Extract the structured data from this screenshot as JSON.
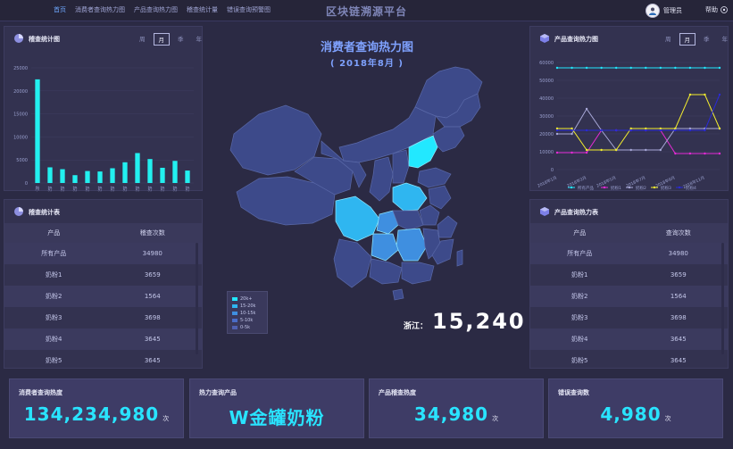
{
  "topbar": {
    "nav": [
      "首页",
      "消费者查询热力图",
      "产品查询热力图",
      "稽查统计量",
      "错误查询预警图"
    ],
    "brand": "区块链溯源平台",
    "user_name": "管理员",
    "help_label": "帮助"
  },
  "audit_chart_panel": {
    "title": "稽查统计图",
    "periods": [
      "周",
      "月",
      "季",
      "年"
    ],
    "active_period": "月"
  },
  "product_chart_panel": {
    "title": "产品查询热力图",
    "periods": [
      "周",
      "月",
      "季",
      "年"
    ],
    "active_period": "月"
  },
  "audit_table": {
    "title": "稽查统计表",
    "headers": [
      "产品",
      "稽查次数"
    ],
    "rows": [
      [
        "所有产品",
        "34980"
      ],
      [
        "奶粉1",
        "3659"
      ],
      [
        "奶粉2",
        "1564"
      ],
      [
        "奶粉3",
        "3698"
      ],
      [
        "奶粉4",
        "3645"
      ],
      [
        "奶粉5",
        "3645"
      ]
    ]
  },
  "product_table": {
    "title": "产品查询热力表",
    "headers": [
      "产品",
      "查询次数"
    ],
    "rows": [
      [
        "所有产品",
        "34980"
      ],
      [
        "奶粉1",
        "3659"
      ],
      [
        "奶粉2",
        "1564"
      ],
      [
        "奶粉3",
        "3698"
      ],
      [
        "奶粉4",
        "3645"
      ],
      [
        "奶粉5",
        "3645"
      ]
    ]
  },
  "map": {
    "title": "消费者查询热力图",
    "subtitle": "( 2018年8月 )",
    "legend": [
      "20k+",
      "15-20k",
      "10-15k",
      "5-10k",
      "0-5k"
    ],
    "legend_colors": [
      "#22e8ff",
      "#2fb6f0",
      "#3f8fe0",
      "#4a6cc7",
      "#5060b0"
    ],
    "highlight_province": "浙江：",
    "highlight_value": "15,240"
  },
  "stats": [
    {
      "label": "消费者查询热度",
      "value": "134,234,980",
      "unit": "次"
    },
    {
      "label": "热力查询产品",
      "value": "W金罐奶粉",
      "unit": ""
    },
    {
      "label": "产品稽查热度",
      "value": "34,980",
      "unit": "次"
    },
    {
      "label": "错误查询数",
      "value": "4,980",
      "unit": "次"
    }
  ],
  "chart_data": [
    {
      "type": "bar",
      "categories": [
        "所有产品",
        "奶粉1",
        "奶粉2",
        "奶粉3",
        "奶粉4",
        "奶粉5",
        "奶粉6",
        "奶粉7",
        "奶粉8",
        "奶粉9",
        "奶粉10",
        "奶粉11",
        "奶粉12"
      ],
      "tick_labels": [
        "所有产品",
        "1",
        "2",
        "3",
        "4",
        "5",
        "6",
        "7",
        "8",
        "9",
        "10",
        "11",
        "12"
      ],
      "values": [
        22500,
        3400,
        3000,
        1700,
        2600,
        2500,
        3200,
        4500,
        6500,
        5200,
        3300,
        4800,
        2700
      ],
      "yticks": [
        0,
        5000,
        10000,
        15000,
        20000,
        25000
      ],
      "ylim": [
        0,
        25000
      ],
      "color": "#22f0f0"
    },
    {
      "type": "line",
      "x": [
        "2018年1月",
        "2018年2月",
        "2018年3月",
        "2018年4月",
        "2018年5月",
        "2018年6月",
        "2018年7月",
        "2018年8月",
        "2018年9月",
        "2018年10月",
        "2018年11月",
        "2018年12月"
      ],
      "xticks": [
        "2018年1月",
        "2018年3月",
        "2018年5月",
        "2018年7月",
        "2018年9月",
        "2018年11月"
      ],
      "yticks": [
        0,
        10000,
        20000,
        30000,
        40000,
        50000,
        60000
      ],
      "ylim": [
        0,
        60000
      ],
      "series": [
        {
          "name": "所有产品",
          "color": "#22e8ff",
          "values": [
            57000,
            57000,
            57000,
            57000,
            57000,
            57000,
            57000,
            57000,
            57000,
            57000,
            57000,
            57000
          ]
        },
        {
          "name": "奶粉1",
          "color": "#e62bd6",
          "values": [
            9500,
            9500,
            9500,
            22000,
            22000,
            22000,
            22000,
            22000,
            9000,
            9000,
            9000,
            9000
          ]
        },
        {
          "name": "奶粉2",
          "color": "#a8a8d8",
          "values": [
            20000,
            20000,
            34000,
            22000,
            11000,
            11000,
            11000,
            11000,
            23000,
            23000,
            23000,
            23000
          ]
        },
        {
          "name": "奶粉3",
          "color": "#f5ef2e",
          "values": [
            23000,
            23000,
            11000,
            11000,
            11000,
            23000,
            23000,
            23000,
            23000,
            42000,
            42000,
            23000
          ]
        },
        {
          "name": "奶粉4",
          "color": "#2a2ad8",
          "values": [
            22000,
            22000,
            22000,
            22000,
            22000,
            22000,
            22000,
            22000,
            22000,
            22000,
            22000,
            42000
          ]
        }
      ]
    }
  ]
}
